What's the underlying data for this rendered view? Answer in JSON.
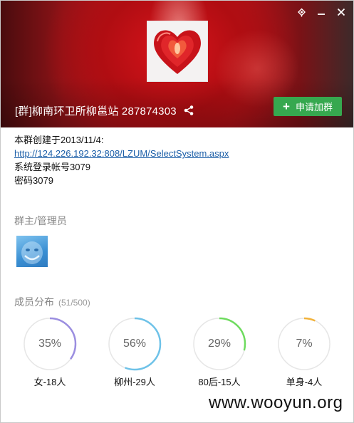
{
  "header": {
    "group_title": "[群]柳南环卫所柳邕站 287874303",
    "join_label": "申请加群"
  },
  "description": {
    "line1": "本群创建于2013/11/4:",
    "link": "http://124.226.192.32:808/LZUM/SelectSystem.aspx",
    "line3": "系统登录帐号3079",
    "line4": "密码3079"
  },
  "admins": {
    "title": "群主/管理员"
  },
  "members": {
    "title": "成员分布",
    "count": "(51/500)",
    "stats": [
      {
        "pct_text": "35%",
        "value": 0.35,
        "label": "女-18人",
        "color": "#9b8ee0"
      },
      {
        "pct_text": "56%",
        "value": 0.56,
        "label": "柳州-29人",
        "color": "#6ec2e8"
      },
      {
        "pct_text": "29%",
        "value": 0.29,
        "label": "80后-15人",
        "color": "#6edb5e"
      },
      {
        "pct_text": "7%",
        "value": 0.07,
        "label": "单身-4人",
        "color": "#f2b23a"
      }
    ]
  },
  "watermark": "www.wooyun.org",
  "icons": [
    "pin-icon",
    "minimize-icon",
    "close-icon",
    "share-icon",
    "plus-icon"
  ]
}
